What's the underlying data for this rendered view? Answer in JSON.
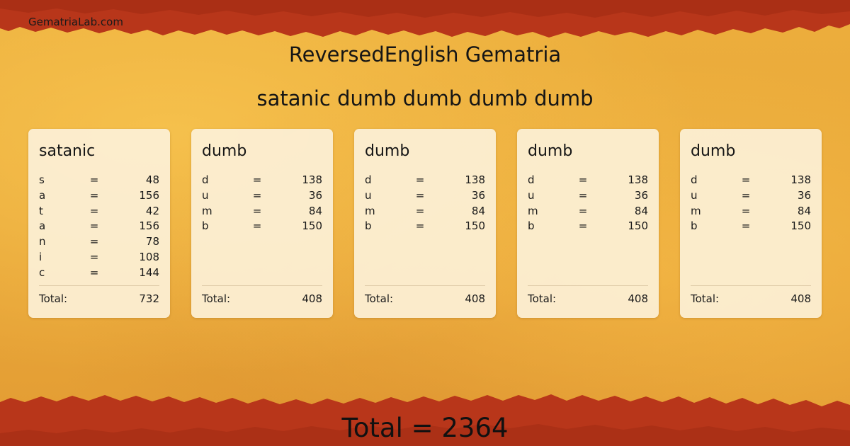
{
  "brand": "GematriaLab.com",
  "title": "ReversedEnglish Gematria",
  "phrase": "satanic dumb dumb dumb dumb",
  "total_label": "Total:",
  "grand_total": "Total = 2364",
  "colors": {
    "background": "#e9a83a",
    "edge_red": "#b8361a",
    "card": "#fcf0d6"
  },
  "cards": [
    {
      "word": "satanic",
      "rows": [
        {
          "ch": "s",
          "eq": "=",
          "val": "48"
        },
        {
          "ch": "a",
          "eq": "=",
          "val": "156"
        },
        {
          "ch": "t",
          "eq": "=",
          "val": "42"
        },
        {
          "ch": "a",
          "eq": "=",
          "val": "156"
        },
        {
          "ch": "n",
          "eq": "=",
          "val": "78"
        },
        {
          "ch": "i",
          "eq": "=",
          "val": "108"
        },
        {
          "ch": "c",
          "eq": "=",
          "val": "144"
        }
      ],
      "total": "732"
    },
    {
      "word": "dumb",
      "rows": [
        {
          "ch": "d",
          "eq": "=",
          "val": "138"
        },
        {
          "ch": "u",
          "eq": "=",
          "val": "36"
        },
        {
          "ch": "m",
          "eq": "=",
          "val": "84"
        },
        {
          "ch": "b",
          "eq": "=",
          "val": "150"
        }
      ],
      "total": "408"
    },
    {
      "word": "dumb",
      "rows": [
        {
          "ch": "d",
          "eq": "=",
          "val": "138"
        },
        {
          "ch": "u",
          "eq": "=",
          "val": "36"
        },
        {
          "ch": "m",
          "eq": "=",
          "val": "84"
        },
        {
          "ch": "b",
          "eq": "=",
          "val": "150"
        }
      ],
      "total": "408"
    },
    {
      "word": "dumb",
      "rows": [
        {
          "ch": "d",
          "eq": "=",
          "val": "138"
        },
        {
          "ch": "u",
          "eq": "=",
          "val": "36"
        },
        {
          "ch": "m",
          "eq": "=",
          "val": "84"
        },
        {
          "ch": "b",
          "eq": "=",
          "val": "150"
        }
      ],
      "total": "408"
    },
    {
      "word": "dumb",
      "rows": [
        {
          "ch": "d",
          "eq": "=",
          "val": "138"
        },
        {
          "ch": "u",
          "eq": "=",
          "val": "36"
        },
        {
          "ch": "m",
          "eq": "=",
          "val": "84"
        },
        {
          "ch": "b",
          "eq": "=",
          "val": "150"
        }
      ],
      "total": "408"
    }
  ]
}
